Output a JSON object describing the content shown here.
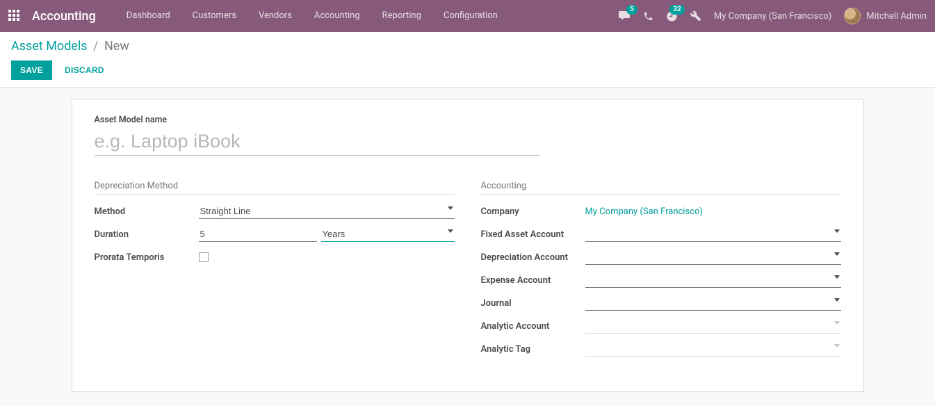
{
  "navbar": {
    "brand": "Accounting",
    "menu": [
      "Dashboard",
      "Customers",
      "Vendors",
      "Accounting",
      "Reporting",
      "Configuration"
    ],
    "messages_badge": "5",
    "activities_badge": "32",
    "company": "My Company (San Francisco)",
    "user": "Mitchell Admin"
  },
  "breadcrumb": {
    "parent": "Asset Models",
    "current": "New"
  },
  "buttons": {
    "save": "SAVE",
    "discard": "DISCARD"
  },
  "form": {
    "title_label": "Asset Model name",
    "title_placeholder": "e.g. Laptop iBook",
    "left_group_title": "Depreciation Method",
    "right_group_title": "Accounting",
    "labels": {
      "method": "Method",
      "duration": "Duration",
      "prorata": "Prorata Temporis",
      "company": "Company",
      "fixed_asset_account": "Fixed Asset Account",
      "depreciation_account": "Depreciation Account",
      "expense_account": "Expense Account",
      "journal": "Journal",
      "analytic_account": "Analytic Account",
      "analytic_tag": "Analytic Tag"
    },
    "values": {
      "method": "Straight Line",
      "duration_number": "5",
      "duration_unit": "Years",
      "company": "My Company (San Francisco)"
    }
  }
}
